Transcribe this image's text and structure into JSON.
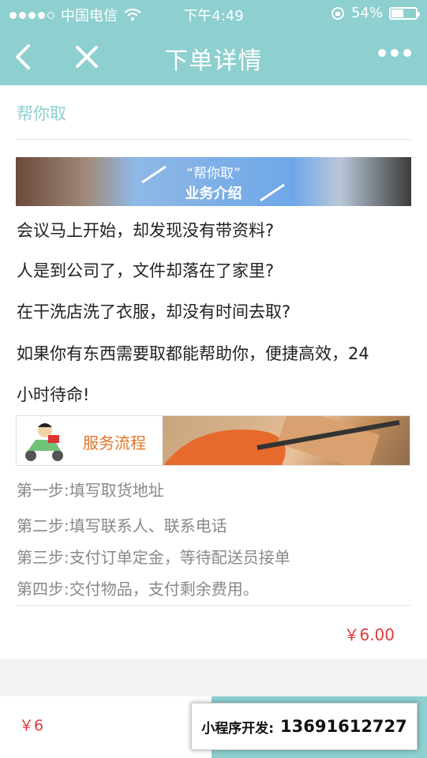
{
  "status_bar": {
    "carrier": "中国电信",
    "time": "下午4:49",
    "battery": "54%",
    "battery_level": 0.54
  },
  "nav": {
    "title": "下单详情"
  },
  "service": {
    "name": "帮你取"
  },
  "banner_top": {
    "line1": "“帮你取”",
    "line2": "业务介绍"
  },
  "intro": [
    "会议马上开始，却发现没有带资料?",
    "人是到公司了，文件却落在了家里?",
    "在干洗店洗了衣服，却没有时间去取?",
    "如果你有东西需要取都能帮助你，便捷高效，24",
    "小时待命!"
  ],
  "process_banner": {
    "label": "服务流程"
  },
  "steps": [
    "第一步:填写取货地址",
    "第二步:填写联系人、联系电话",
    "第三步:支付订单定金，等待配送员接单",
    "第四步:交付物品，支付剩余费用。"
  ],
  "card_price": "￥6.00",
  "bottom": {
    "price": "￥6"
  },
  "promo": {
    "label": "小程序开发:",
    "phone": "13691612727"
  },
  "colors": {
    "theme": "#8ecfcf",
    "price": "#e03a3a",
    "accent_orange": "#e0762a"
  }
}
